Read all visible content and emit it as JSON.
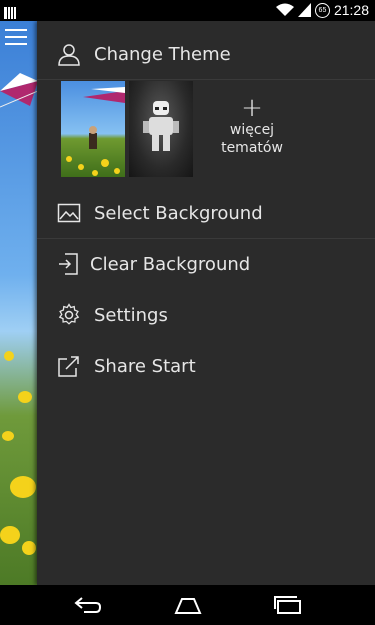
{
  "status_bar": {
    "time": "21:28",
    "battery": "65",
    "icons": [
      "notification-icon",
      "wifi-icon",
      "signal-icon",
      "battery-icon"
    ]
  },
  "drawer": {
    "change_theme": "Change Theme",
    "more_themes_line1": "więcej",
    "more_themes_line2": "tematów",
    "plus": "+",
    "select_background": "Select Background",
    "clear_background": "Clear Background",
    "settings": "Settings",
    "share_start": "Share Start"
  },
  "colors": {
    "drawer_bg": "#2b2b2b",
    "text": "#e6e6e6"
  }
}
